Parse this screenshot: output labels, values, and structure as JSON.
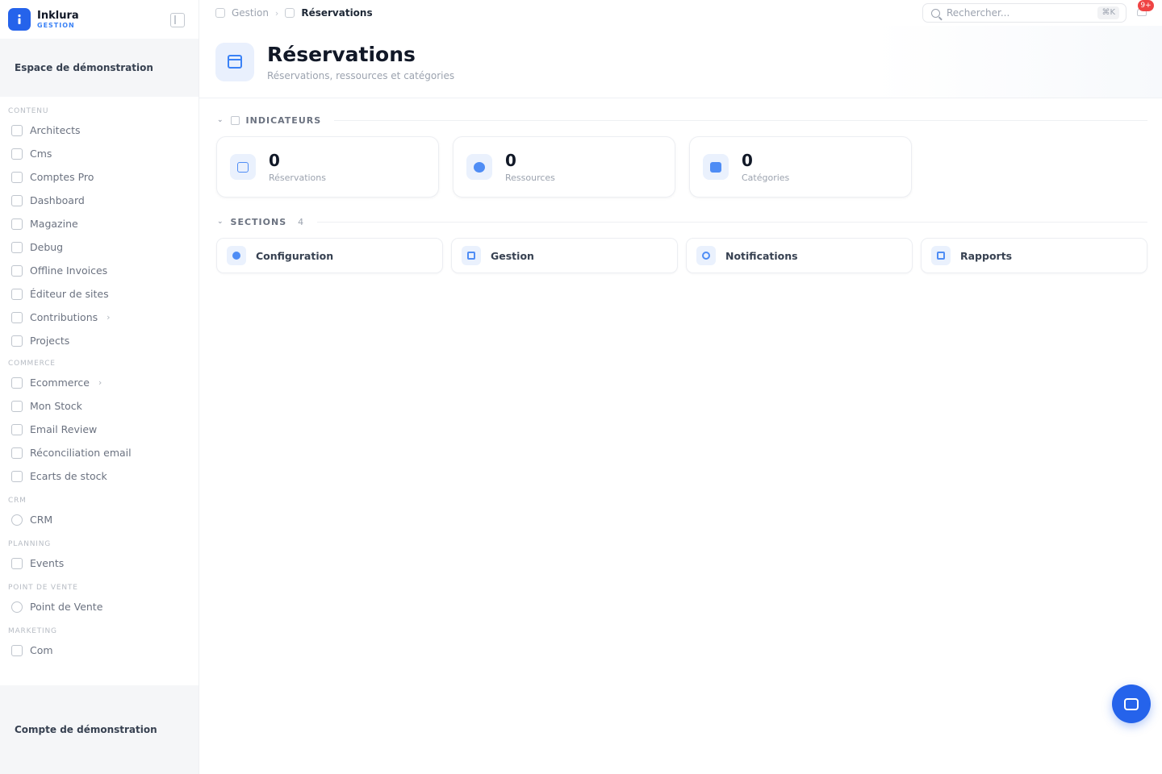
{
  "brand": {
    "name": "Inklura",
    "sub": "GESTION"
  },
  "sidebar": {
    "workspace": "Espace de démonstration",
    "account": "Compte de démonstration",
    "sections": [
      {
        "label": "CONTENU",
        "items": [
          {
            "label": "Architects",
            "icon": "building-icon"
          },
          {
            "label": "Cms",
            "icon": "document-icon"
          },
          {
            "label": "Comptes Pro",
            "icon": "document-icon"
          },
          {
            "label": "Dashboard",
            "icon": "grid-icon"
          },
          {
            "label": "Magazine",
            "icon": "newspaper-icon"
          },
          {
            "label": "Debug",
            "icon": "newspaper-icon"
          },
          {
            "label": "Offline Invoices",
            "icon": "newspaper-icon"
          },
          {
            "label": "Éditeur de sites",
            "icon": "terminal-icon"
          },
          {
            "label": "Contributions",
            "icon": "inbox-icon",
            "chevron": "›"
          },
          {
            "label": "Projects",
            "icon": "folder-icon"
          }
        ]
      },
      {
        "label": "COMMERCE",
        "items": [
          {
            "label": "Ecommerce",
            "icon": "cart-icon",
            "chevron": "›"
          },
          {
            "label": "Mon Stock",
            "icon": "cart-icon"
          },
          {
            "label": "Email Review",
            "icon": "cart-icon"
          },
          {
            "label": "Réconciliation email",
            "icon": "cart-icon"
          },
          {
            "label": "Ecarts de stock",
            "icon": "cart-icon"
          }
        ]
      },
      {
        "label": "CRM",
        "items": [
          {
            "label": "CRM",
            "icon": "user-icon"
          }
        ]
      },
      {
        "label": "PLANNING",
        "items": [
          {
            "label": "Events",
            "icon": "calendar-icon"
          }
        ]
      },
      {
        "label": "POINT DE VENTE",
        "items": [
          {
            "label": "Point de Vente",
            "icon": "store-icon"
          }
        ]
      },
      {
        "label": "MARKETING",
        "items": [
          {
            "label": "Com",
            "icon": "megaphone-icon"
          }
        ]
      }
    ]
  },
  "topbar": {
    "breadcrumb": {
      "parent": "Gestion",
      "separator": "›",
      "current": "Réservations"
    },
    "search": {
      "placeholder": "Rechercher...",
      "shortcut": "⌘K"
    },
    "notifications": {
      "count": "9+"
    }
  },
  "header": {
    "title": "Réservations",
    "subtitle": "Réservations, ressources et catégories"
  },
  "indicators": {
    "label": "INDICATEURS",
    "items": [
      {
        "value": "0",
        "label": "Réservations"
      },
      {
        "value": "0",
        "label": "Ressources"
      },
      {
        "value": "0",
        "label": "Catégories"
      }
    ]
  },
  "sections": {
    "label": "SECTIONS",
    "count": "4",
    "items": [
      {
        "label": "Configuration"
      },
      {
        "label": "Gestion"
      },
      {
        "label": "Notifications"
      },
      {
        "label": "Rapports"
      }
    ]
  },
  "colors": {
    "accent": "#2563eb",
    "badge": "#ef4444"
  }
}
